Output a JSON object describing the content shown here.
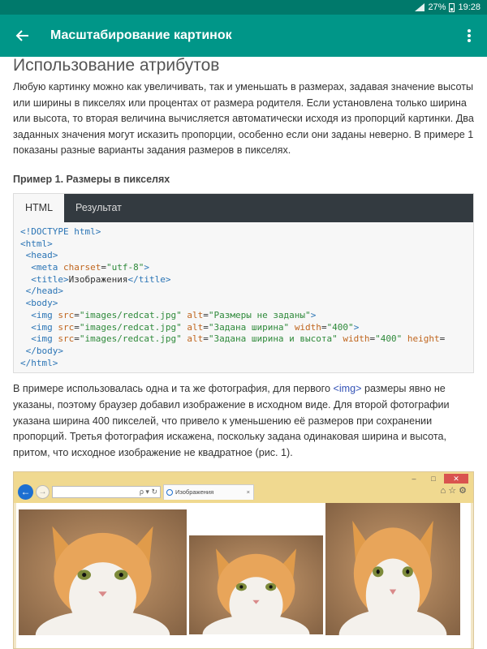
{
  "statusbar": {
    "battery": "27%",
    "time": "19:28"
  },
  "appbar": {
    "title": "Масштабирование картинок"
  },
  "article": {
    "heading": "Использование атрибутов",
    "paragraph1": "Любую картинку можно как увеличивать, так и уменьшать в размерах, задавая значение высоты или ширины в пикселях или процентах от размера родителя. Если установлена только ширина или высота, то вторая величина вычисляется автоматически исходя из пропорций картинки. Два заданных значения могут исказить пропорции, особенно если они заданы неверно. В примере 1 показаны разные варианты задания размеров в пикселях.",
    "example_title": "Пример 1. Размеры в пикселях",
    "tabs": [
      "HTML",
      "Результат"
    ],
    "paragraph2_before": "В примере использовалась одна и та же фотография, для первого ",
    "paragraph2_tag": "<img>",
    "paragraph2_after": " размеры явно не указаны, поэтому браузер добавил изображение в исходном виде. Для второй фотографии указана ширина 400 пикселей, что привело к уменьшению её размеров при сохранении пропорций. Третья фотография искажена, поскольку задана одинаковая ширина и высота, притом, что исходное изображение не квадратное (рис. 1)."
  },
  "code": {
    "doctype": "<!DOCTYPE html>",
    "html_open": "<html>",
    "head_open": "<head>",
    "meta_tag": "<meta",
    "meta_attr": "charset",
    "meta_val": "\"utf-8\"",
    "title_open": "<title>",
    "title_text": "Изображения",
    "title_close": "</title>",
    "head_close": "</head>",
    "body_open": "<body>",
    "img_tag": "<img",
    "src_attr": "src",
    "src_val": "\"images/redcat.jpg\"",
    "alt_attr": "alt",
    "alt1_val": "\"Размеры не заданы\"",
    "alt2_val": "\"Задана ширина\"",
    "alt3_val": "\"Задана ширина и высота\"",
    "width_attr": "width",
    "width_val": "\"400\"",
    "height_attr": "height",
    "height_val": "=",
    "gt": ">",
    "body_close": "</body>",
    "html_close": "</html>"
  },
  "browser": {
    "tab_title": "Изображения",
    "address_icons": "ρ ▾ ↻",
    "controls": [
      "–",
      "□",
      "✕"
    ],
    "tools": "⌂ ☆ ⚙"
  },
  "colors": {
    "appbar": "#009688",
    "statusbar": "#00796b",
    "tag": "#2a74b5",
    "attr": "#c0661f",
    "value": "#2f8a3b"
  }
}
